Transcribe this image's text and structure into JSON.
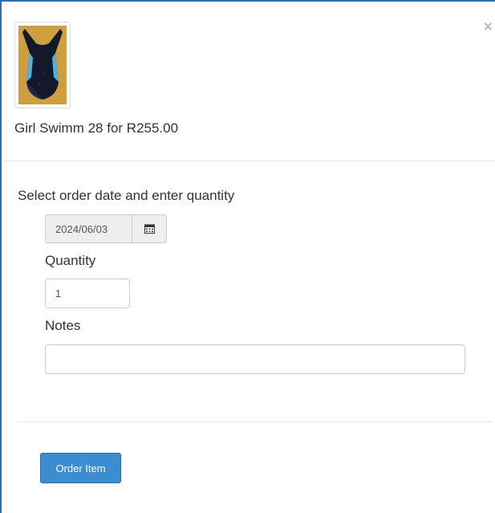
{
  "modal": {
    "close_label": "×",
    "product": {
      "image_alt": "Girl Swimm 28 swimsuit",
      "title": "Girl Swimm 28 for R255.00"
    },
    "instruction": "Select order date and enter quantity",
    "date": {
      "value": "2024/06/03",
      "icon": "calendar-icon"
    },
    "quantity": {
      "label": "Quantity",
      "value": "1"
    },
    "notes": {
      "label": "Notes",
      "value": ""
    },
    "order_button": "Order Item",
    "colors": {
      "accent": "#3c8dd0",
      "border": "#2a6fb0"
    }
  }
}
